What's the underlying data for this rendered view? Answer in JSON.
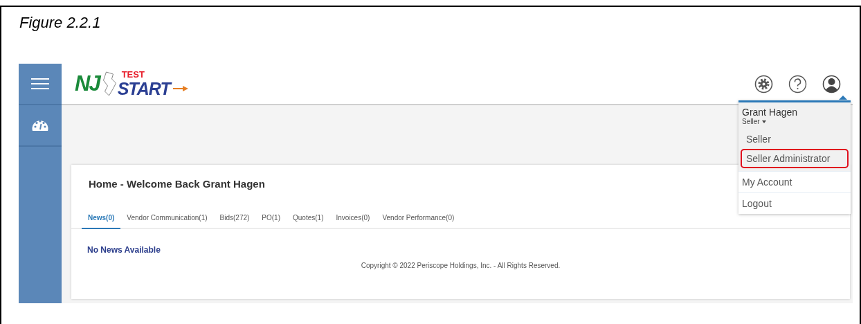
{
  "figure": {
    "caption": "Figure 2.2.1"
  },
  "logo": {
    "prefix": "NJ",
    "name": "START",
    "stamp": "TEST"
  },
  "user_menu": {
    "name": "Grant Hagen",
    "role": "Seller",
    "roles": [
      {
        "label": "Seller",
        "highlighted": false
      },
      {
        "label": "Seller Administrator",
        "highlighted": true
      }
    ],
    "items": [
      "My Account",
      "Logout"
    ]
  },
  "home": {
    "title": "Home - Welcome Back Grant Hagen",
    "tabs": [
      {
        "label": "News(0)",
        "selected": true
      },
      {
        "label": "Vendor Communication(1)",
        "selected": false
      },
      {
        "label": "Bids(272)",
        "selected": false
      },
      {
        "label": "PO(1)",
        "selected": false
      },
      {
        "label": "Quotes(1)",
        "selected": false
      },
      {
        "label": "Invoices(0)",
        "selected": false
      },
      {
        "label": "Vendor Performance(0)",
        "selected": false
      }
    ],
    "message": "No News Available",
    "footer": "Copyright © 2022 Periscope Holdings, Inc. - All Rights Reserved."
  }
}
